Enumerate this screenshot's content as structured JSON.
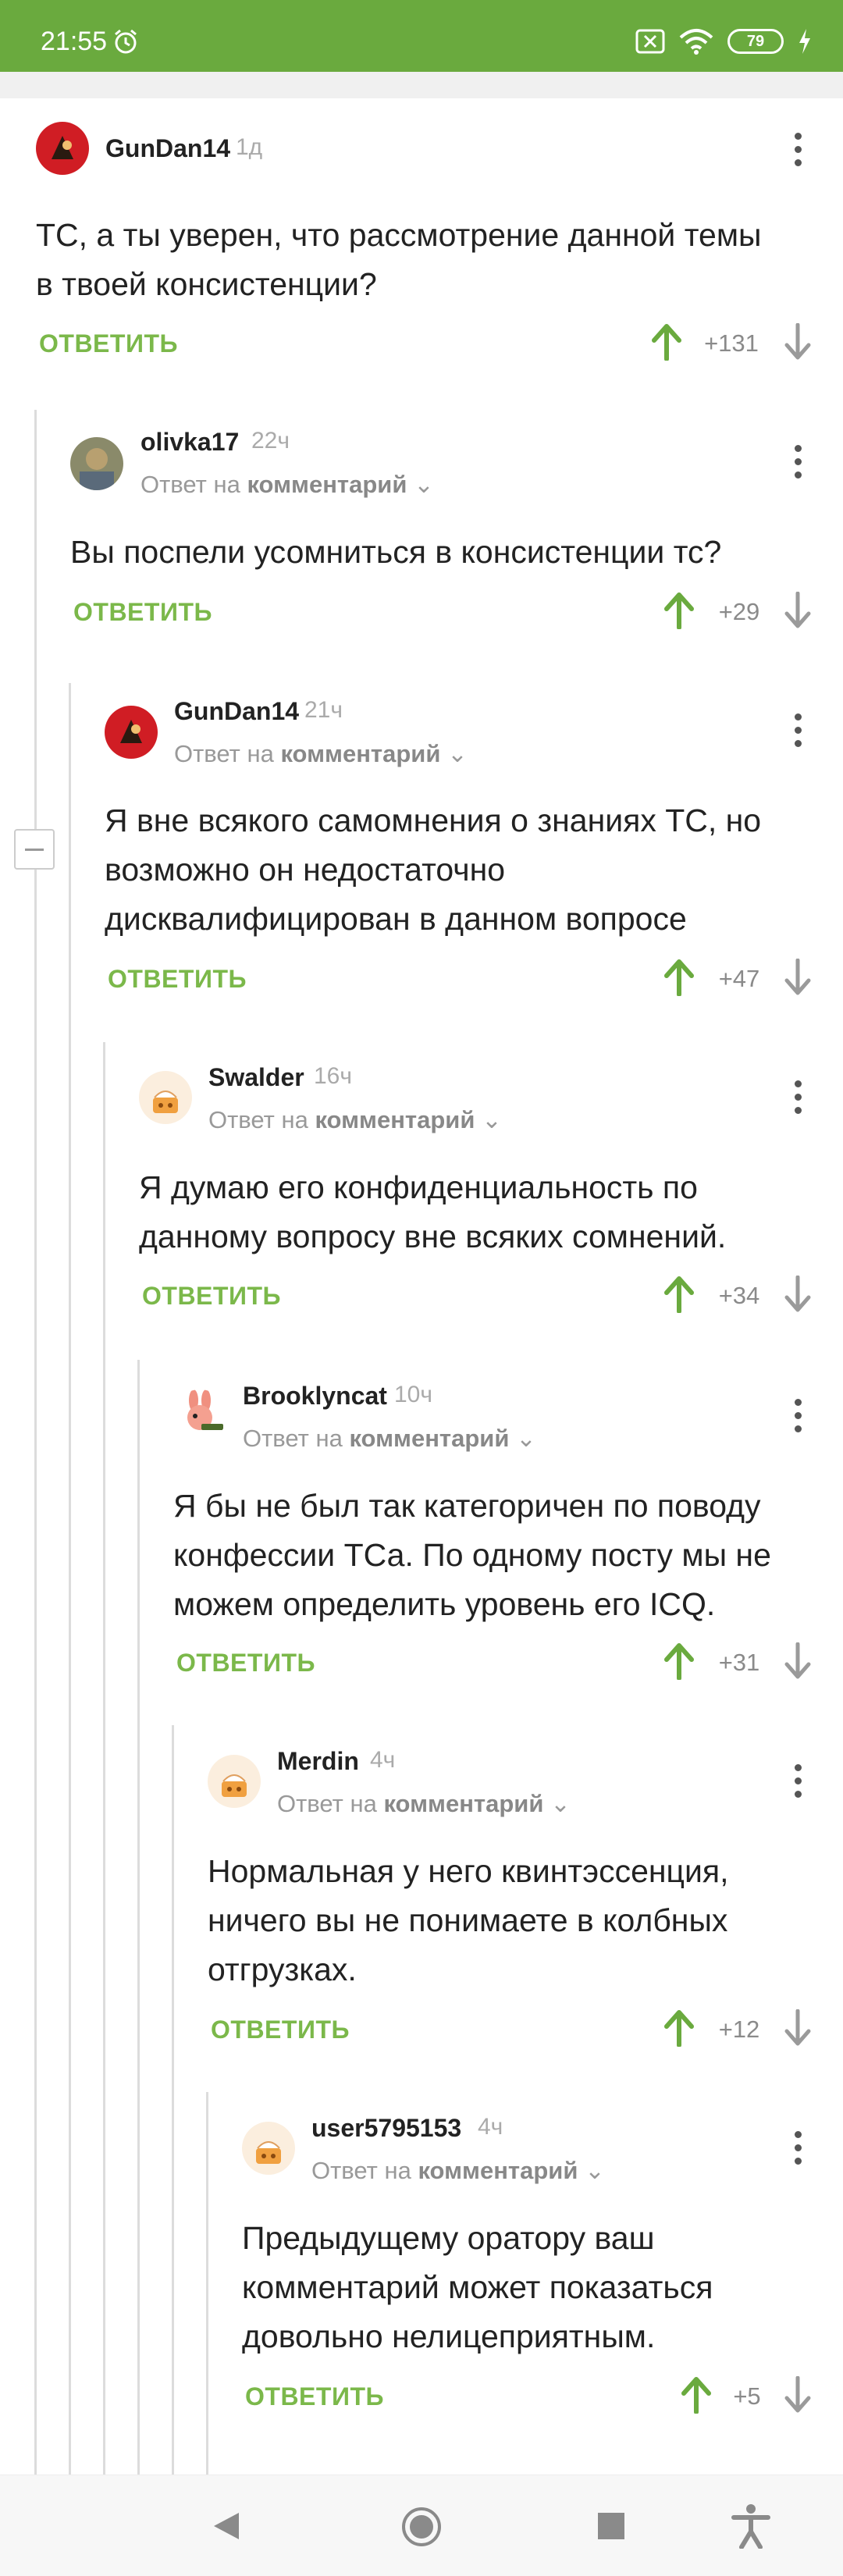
{
  "status_bar": {
    "time": "21:55",
    "battery": "79"
  },
  "reply_label": "ОТВЕТИТЬ",
  "reply_to_prefix": "Ответ на",
  "reply_to_target": "комментарий",
  "comments": [
    {
      "username": "GunDan14",
      "time": "1д",
      "text": "ТС, а ты уверен, что рассмотрение данной темы в твоей консистенции?",
      "score": "+131",
      "avatar": "red-logo"
    },
    {
      "username": "olivka17",
      "time": "22ч",
      "text": "Вы поспели усомниться в консистенции тс?",
      "score": "+29",
      "avatar": "photo"
    },
    {
      "username": "GunDan14",
      "time": "21ч",
      "text": "Я вне всякого самомнения о знаниях ТС, но возможно он недостаточно дисквалифицирован в данном вопросе",
      "score": "+47",
      "avatar": "red-logo"
    },
    {
      "username": "Swalder",
      "time": "16ч",
      "text": "Я думаю его конфиденциальность по данному вопросу вне всяких сомнений.",
      "score": "+34",
      "avatar": "default-cake"
    },
    {
      "username": "Brooklyncat",
      "time": "10ч",
      "text": "Я бы не был так категоричен по поводу конфессии ТСа. По одному посту мы не можем определить уровень его ICQ.",
      "score": "+31",
      "avatar": "bunny"
    },
    {
      "username": "Merdin",
      "time": "4ч",
      "text": "Нормальная у него квинтэссенция, ничего вы не понимаете в колбных отгрузках.",
      "score": "+12",
      "avatar": "default-cake"
    },
    {
      "username": "user5795153",
      "time": "4ч",
      "text": "Предыдущему оратору ваш комментарий может показаться довольно нелицеприятным.",
      "score": "+5",
      "avatar": "default-cake"
    }
  ],
  "colors": {
    "accent": "#6aaa3e",
    "reply_green": "#7bb84a",
    "text": "#222222",
    "muted": "#999999"
  }
}
